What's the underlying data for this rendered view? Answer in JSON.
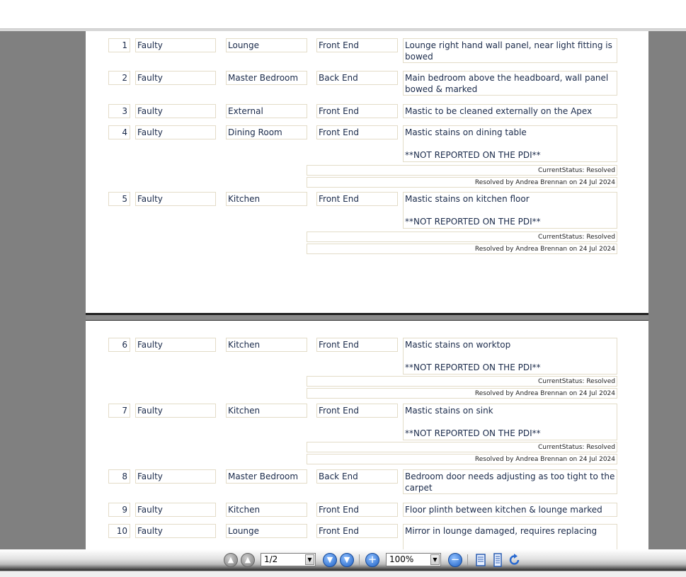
{
  "pages": [
    {
      "rows": [
        {
          "num": "1",
          "status": "Faulty",
          "room": "Lounge",
          "elevation": "Front End",
          "desc": [
            "Lounge right hand wall panel, near light fitting is",
            "bowed"
          ]
        },
        {
          "num": "2",
          "status": "Faulty",
          "room": "Master Bedroom",
          "elevation": "Back End",
          "desc": [
            "Main bedroom above the headboard, wall panel",
            "bowed & marked"
          ]
        },
        {
          "num": "3",
          "status": "Faulty",
          "room": "External",
          "elevation": "Front End",
          "desc": [
            "Mastic to be cleaned externally on the Apex"
          ]
        },
        {
          "num": "4",
          "status": "Faulty",
          "room": "Dining Room",
          "elevation": "Front End",
          "desc": [
            "Mastic stains on dining table",
            "",
            "**NOT REPORTED ON THE PDI**"
          ],
          "current_status": "CurrentStatus: Resolved",
          "resolved": "Resolved by Andrea Brennan on 24 Jul 2024"
        },
        {
          "num": "5",
          "status": "Faulty",
          "room": "Kitchen",
          "elevation": "Front End",
          "desc": [
            "Mastic stains on kitchen floor",
            "",
            "**NOT REPORTED ON THE PDI**"
          ],
          "current_status": "CurrentStatus: Resolved",
          "resolved": "Resolved by Andrea Brennan on 24 Jul 2024"
        }
      ]
    },
    {
      "rows": [
        {
          "num": "6",
          "status": "Faulty",
          "room": "Kitchen",
          "elevation": "Front End",
          "desc": [
            "Mastic stains on worktop",
            "",
            "**NOT REPORTED ON THE PDI**"
          ],
          "current_status": "CurrentStatus: Resolved",
          "resolved": "Resolved by Andrea Brennan on 24 Jul 2024"
        },
        {
          "num": "7",
          "status": "Faulty",
          "room": "Kitchen",
          "elevation": "Front End",
          "desc": [
            "Mastic stains on sink",
            "",
            "**NOT REPORTED ON THE PDI**"
          ],
          "current_status": "CurrentStatus: Resolved",
          "resolved": "Resolved by Andrea Brennan on 24 Jul 2024"
        },
        {
          "num": "8",
          "status": "Faulty",
          "room": "Master Bedroom",
          "elevation": "Back End",
          "desc": [
            "Bedroom door needs adjusting as too tight to the",
            "carpet"
          ]
        },
        {
          "num": "9",
          "status": "Faulty",
          "room": "Kitchen",
          "elevation": "Front End",
          "desc": [
            "Floor plinth between kitchen & lounge marked"
          ]
        },
        {
          "num": "10",
          "status": "Faulty",
          "room": "Lounge",
          "elevation": "Front End",
          "desc": [
            "Mirror in lounge damaged, requires replacing"
          ]
        }
      ]
    }
  ],
  "toolbar": {
    "page_select": "1/2",
    "zoom_select": "100%",
    "icons": [
      "first-page-icon",
      "previous-page-icon",
      "next-page-icon",
      "last-page-icon",
      "zoom-in-icon",
      "zoom-out-icon",
      "fit-width-icon",
      "fit-page-icon",
      "rotate-icon"
    ]
  }
}
